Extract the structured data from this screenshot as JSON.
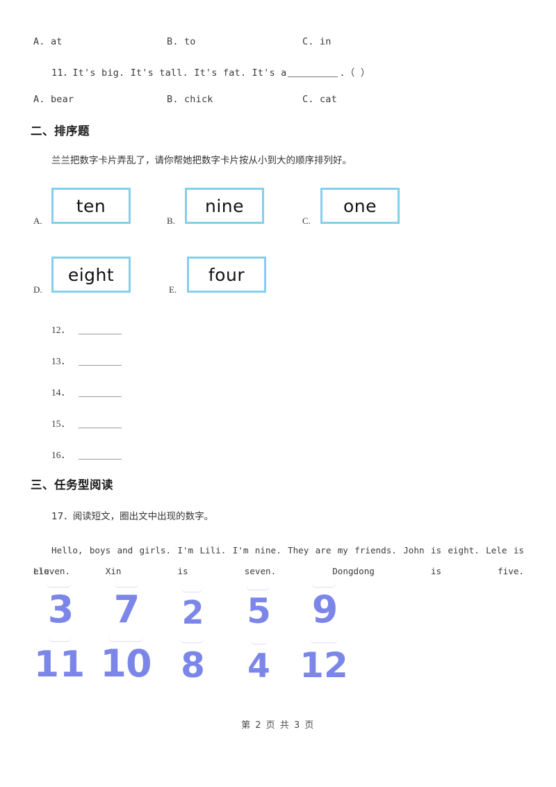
{
  "question_10_options": {
    "a": "A. at",
    "b": "B. to",
    "c": "C. in"
  },
  "question_11": {
    "number": "11．",
    "text_before": "It's big. It's tall. It's fat. It's a",
    "text_after": ".（     ）",
    "options": {
      "a": "A. bear",
      "b": "B. chick",
      "c": "C. cat"
    }
  },
  "section_two": {
    "heading": "二、排序题",
    "instruction": "兰兰把数字卡片弄乱了，请你帮她把数字卡片按从小到大的顺序排列好。",
    "cards": [
      {
        "label": "A.",
        "word": "ten"
      },
      {
        "label": "B.",
        "word": "nine"
      },
      {
        "label": "C.",
        "word": "one"
      },
      {
        "label": "D.",
        "word": "eight"
      },
      {
        "label": "E.",
        "word": "four"
      }
    ],
    "answer_rows": [
      {
        "number": "12．"
      },
      {
        "number": "13．"
      },
      {
        "number": "14．"
      },
      {
        "number": "15．"
      },
      {
        "number": "16．"
      }
    ]
  },
  "section_three": {
    "heading": "三、任务型阅读",
    "item_number": "17．",
    "instruction": "阅读短文，圈出文中出现的数字。",
    "passage_line_1": "Hello, boys and girls. I'm Lili. I'm nine. They are my friends. John is eight. Lele is eleven.",
    "passage_line_2": "Liu Xin is seven. Dongdong is five.",
    "number_grid": {
      "row_1": [
        "3",
        "7",
        "2",
        "5",
        "9"
      ],
      "row_2": [
        "11",
        "10",
        "8",
        "4",
        "12"
      ]
    },
    "number_color": "#7b86e8"
  },
  "card_border_color": "#84cfec",
  "footer": "第 2 页 共 3 页"
}
